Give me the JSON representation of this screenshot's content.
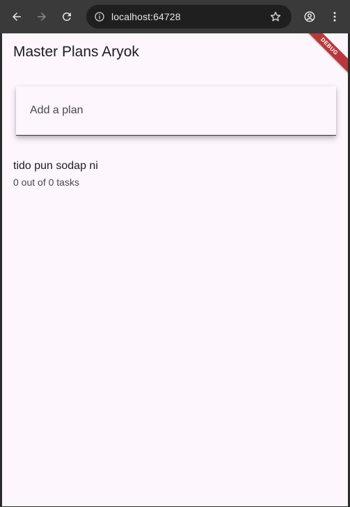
{
  "browser": {
    "url": "localhost:64728",
    "icons": {
      "back": "arrow-left-icon",
      "forward": "arrow-right-icon",
      "reload": "reload-icon",
      "info": "info-icon",
      "bookmark": "star-icon",
      "profile": "account-icon",
      "menu": "more-vert-icon"
    }
  },
  "app": {
    "title": "Master Plans Aryok",
    "debug_banner": "DEBUG",
    "input": {
      "placeholder": "Add a plan"
    },
    "plans": [
      {
        "name": "tido pun sodap ni",
        "progress": "0 out of 0 tasks"
      }
    ]
  },
  "colors": {
    "background": "#fdf6fd",
    "chrome": "#3a3a3a",
    "debug": "#b9393b"
  }
}
